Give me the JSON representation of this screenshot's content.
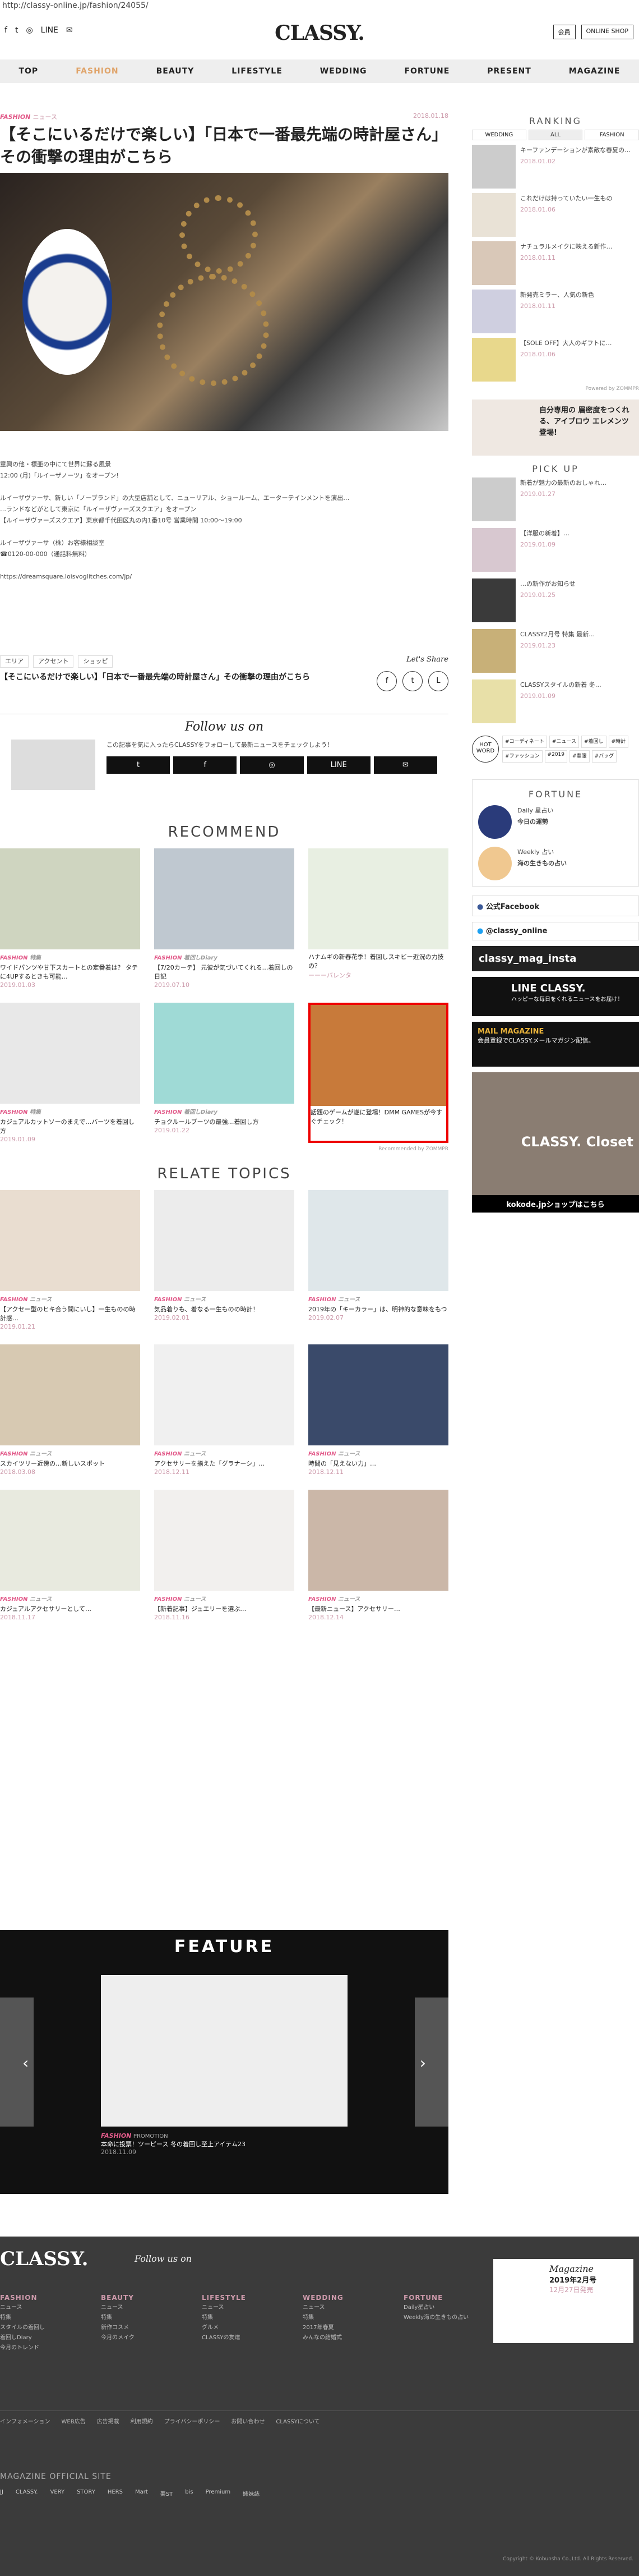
{
  "url": "http://classy-online.jp/fashion/24055/",
  "header": {
    "line": "LINE",
    "logo": "CLASSY.",
    "btn1": "会員",
    "btn2": "ONLINE SHOP"
  },
  "nav": [
    "TOP",
    "FASHION",
    "BEAUTY",
    "LIFESTYLE",
    "WEDDING",
    "FORTUNE",
    "PRESENT",
    "MAGAZINE"
  ],
  "article": {
    "category": "FASHION",
    "sub": "ニュース",
    "date": "2018.01.18",
    "title": "【そこにいるだけで楽しい】「日本で一番最先端の時計屋さん」その衝撃の理由がこちら",
    "p1": "童興の他・標亜の中にて世界に蘇る風景",
    "p2": "12:00 (月)「ルイーザノーツ」をオープン!",
    "p3": "ルイーザヴァーサ、新しい「ノーブランド」の大型店舗として、ニューリアル、ショールーム、エーターテインメントを演出…",
    "p4": "…ランドなどがとして東京に「ルイーザヴァーズスクエア」をオープン",
    "p5": "【ルイーザヴァーズスクエア】東京都千代田区丸の内1番10号 営業時間 10:00～19:00",
    "p6": "ルイーザヴァーサ（株）お客様相談室",
    "p7": "☎0120-00-000（通話料無料）",
    "p8": "https://dreamsquare.loisvoglitches.com/jp/",
    "tags": [
      "エリア",
      "アクセント",
      "ショッピ"
    ],
    "share": "Let's Share",
    "title2": "【そこにいるだけで楽しい】「日本で一番最先端の時計屋さん」その衝撃の理由がこちら",
    "follow": "Follow us on",
    "follow_text": "この記事を気に入ったらCLASSYをフォローして最新ニュースをチェックしよう！",
    "follow_btns": [
      "t",
      "f",
      "◎",
      "LINE",
      "✉"
    ]
  },
  "recommend": {
    "heading": "RECOMMEND",
    "items": [
      {
        "cat": "FASHION",
        "sub": "特集",
        "title": "ワイドパンツや甘下スカートとの定番着は？ タテに4UPするときも可能…",
        "date": "2019.01.03"
      },
      {
        "cat": "FASHION",
        "sub": "着回しDiary",
        "title": "【7/20カーテ】 元彼が気づいてくれる…着回しの日記",
        "date": "2019.07.10"
      },
      {
        "cat": "",
        "sub": "",
        "title": "ハナムギの新春花季！着回しスキビー近況の力技の？",
        "date": "ーーーバレンタ"
      },
      {
        "cat": "FASHION",
        "sub": "特集",
        "title": "カジュアルカットソーのまえで…バーツを着回し方",
        "date": "2019.01.09"
      },
      {
        "cat": "FASHION",
        "sub": "着回しDiary",
        "title": "チョクルールブーツの最強…着回し方",
        "date": "2019.01.22"
      },
      {
        "cat": "",
        "sub": "",
        "title": "話題のゲームが遂に登場！DMM GAMESが今すぐチェック！",
        "date": ""
      }
    ],
    "powered": "Recommended by ZOMMPR"
  },
  "relate": {
    "heading": "RELATE TOPICS",
    "items": [
      {
        "cat": "FASHION",
        "sub": "ニュース",
        "title": "【アクセー型のヒキ合う間にいし】一生ものの時計感…",
        "date": "2019.01.21"
      },
      {
        "cat": "FASHION",
        "sub": "ニュース",
        "title": "気品着りも、着なる一生ものの時計！",
        "date": "2019.02.01"
      },
      {
        "cat": "FASHION",
        "sub": "ニュース",
        "title": "2019年の「キーカラー」は、明神的な意味をもつ",
        "date": "2019.02.07"
      },
      {
        "cat": "FASHION",
        "sub": "ニュース",
        "title": "スカイツリー近傍の…新しいスポット",
        "date": "2018.03.08"
      },
      {
        "cat": "FASHION",
        "sub": "ニュース",
        "title": "アクセサリーを揃えた「グラナーシ」…",
        "date": "2018.12.11"
      },
      {
        "cat": "FASHION",
        "sub": "ニュース",
        "title": "時間の「見えない力」…",
        "date": "2018.12.11"
      },
      {
        "cat": "FASHION",
        "sub": "ニュース",
        "title": "カジュアルアクセサリーとして…",
        "date": "2018.11.17"
      },
      {
        "cat": "FASHION",
        "sub": "ニュース",
        "title": "【新着記事】ジュエリーを選ぶ…",
        "date": "2018.11.16"
      },
      {
        "cat": "FASHION",
        "sub": "ニュース",
        "title": "【最新ニュース】アクセサリー…",
        "date": "2018.12.14"
      }
    ]
  },
  "feature": {
    "heading": "FEATURE",
    "cat": "FASHION",
    "sub": "PROMOTION",
    "title": "本命に投票！ツーピース 冬の着回し至上アイテム23",
    "date": "2018.11.09"
  },
  "sidebar": {
    "ranking": "RANKING",
    "tabs": [
      "WEDDING",
      "ALL",
      "FASHION"
    ],
    "rank": [
      {
        "t": "キーファンデーションが素敵な春夏の…",
        "d": "2018.01.02"
      },
      {
        "t": "これだけは持っていたい一生もの",
        "d": "2018.01.06"
      },
      {
        "t": "ナチュラルメイクに映える新作…",
        "d": "2018.01.11"
      },
      {
        "t": "新発売ミラー、人気の新色",
        "d": "2018.01.11"
      },
      {
        "t": "【SOLE OFF】大人のギフトに…",
        "d": "2018.01.06"
      }
    ],
    "rank_powered": "Powered by ZOMMPR",
    "banner1": "自分専用の 眉密度をつくれる、アイブロウ エレメンツ登場!",
    "pickup": "PICK UP",
    "picks": [
      {
        "t": "新着が魅力の最新のおしゃれ…",
        "d": "2019.01.27"
      },
      {
        "t": "【洋服の新着】…",
        "d": "2019.01.09"
      },
      {
        "t": "…の新作がお知らせ",
        "d": "2019.01.25"
      },
      {
        "t": "CLASSY2月号 特集 最新…",
        "d": "2019.01.23"
      },
      {
        "t": "CLASSYスタイルの新着 冬…",
        "d": "2019.01.09"
      }
    ],
    "hot": "HOT WORD",
    "hotwords": [
      "#コーディネート",
      "#ニュース",
      "#着回し",
      "#時計",
      "#ファッション",
      "#2019",
      "#春服",
      "#バッグ"
    ],
    "fortune": "FORTUNE",
    "f1": "Daily 星占い",
    "f1b": "今日の運勢",
    "f2": "Weekly 占い",
    "f2b": "海の生きもの占い",
    "facebook": "公式Facebook",
    "twitter": "@classy_online",
    "insta": "classy_mag_insta",
    "line": "LINE CLASSY.",
    "line_sub": "ハッピーな毎日をくれるニュースをお届け！",
    "mail": "MAIL MAGAZINE",
    "mail_sub": "会員登録でCLASSY.メールマガジン配信。",
    "closet": "CLASSY. Closet",
    "closet_sub": "kokode.jpショップはこちら"
  },
  "footer": {
    "logo": "CLASSY.",
    "follow": "Follow us on",
    "magazine": "Magazine",
    "issue": "2019年2月号",
    "release": "12月27日発売",
    "cols": [
      {
        "h": "FASHION",
        "items": [
          "ニュース",
          "特集",
          "スタイルの着回し",
          "着回しDiary",
          "今月のトレンド"
        ]
      },
      {
        "h": "BEAUTY",
        "items": [
          "ニュース",
          "特集",
          "新作コスメ",
          "今月のメイク"
        ]
      },
      {
        "h": "LIFESTYLE",
        "items": [
          "ニュース",
          "特集",
          "グルメ",
          "CLASSYの友達"
        ]
      },
      {
        "h": "WEDDING",
        "items": [
          "ニュース",
          "特集",
          "2017年春夏",
          "みんなの結婚式"
        ]
      },
      {
        "h": "FORTUNE",
        "items": [
          "Daily星占い",
          "Weekly海の生きもの占い"
        ]
      }
    ],
    "links": [
      "インフォメーション",
      "WEB広告",
      "広告掲載",
      "利用規約",
      "プライバシーポリシー",
      "お問い合わせ",
      "CLASSYについて"
    ],
    "mos": "MAGAZINE OFFICIAL SITE",
    "sites": [
      "JJ",
      "CLASSY.",
      "VERY",
      "STORY",
      "HERS",
      "Mart",
      "美ST",
      "bis",
      "Premium",
      "姉妹誌"
    ],
    "copy": "Copyright © Kobunsha Co.,Ltd. All Rights Reserved."
  }
}
